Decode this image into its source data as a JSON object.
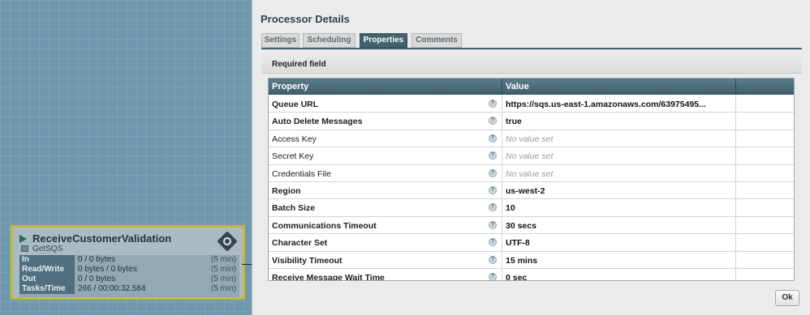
{
  "processor": {
    "name": "ReceiveCustomerValidation",
    "type": "GetSQS",
    "stats": [
      {
        "label": "In",
        "value": "0 / 0 bytes",
        "window": "(5 min)"
      },
      {
        "label": "Read/Write",
        "value": "0 bytes / 0 bytes",
        "window": "(5 min)"
      },
      {
        "label": "Out",
        "value": "0 / 0 bytes",
        "window": "(5 min)"
      },
      {
        "label": "Tasks/Time",
        "value": "266 / 00:00:32.584",
        "window": "(5 min)"
      }
    ]
  },
  "dialog": {
    "title": "Processor Details",
    "tabs": [
      "Settings",
      "Scheduling",
      "Properties",
      "Comments"
    ],
    "active_tab": "Properties",
    "required_label": "Required field",
    "grid": {
      "headers": {
        "property": "Property",
        "value": "Value"
      },
      "help_glyph": "?",
      "rows": [
        {
          "name": "Queue URL",
          "value": "https://sqs.us-east-1.amazonaws.com/63975495...",
          "required": true,
          "empty": false
        },
        {
          "name": "Auto Delete Messages",
          "value": "true",
          "required": true,
          "empty": false
        },
        {
          "name": "Access Key",
          "value": "No value set",
          "required": false,
          "empty": true
        },
        {
          "name": "Secret Key",
          "value": "No value set",
          "required": false,
          "empty": true
        },
        {
          "name": "Credentials File",
          "value": "No value set",
          "required": false,
          "empty": true
        },
        {
          "name": "Region",
          "value": "us-west-2",
          "required": true,
          "empty": false
        },
        {
          "name": "Batch Size",
          "value": "10",
          "required": true,
          "empty": false
        },
        {
          "name": "Communications Timeout",
          "value": "30 secs",
          "required": true,
          "empty": false
        },
        {
          "name": "Character Set",
          "value": "UTF-8",
          "required": true,
          "empty": false
        },
        {
          "name": "Visibility Timeout",
          "value": "15 mins",
          "required": true,
          "empty": false
        },
        {
          "name": "Receive Message Wait Time",
          "value": "0 sec",
          "required": true,
          "empty": false
        }
      ]
    },
    "ok_label": "Ok"
  },
  "colors": {
    "canvas": "#6f97ad",
    "accent": "#43626f",
    "processor_border": "#c6b83c"
  }
}
